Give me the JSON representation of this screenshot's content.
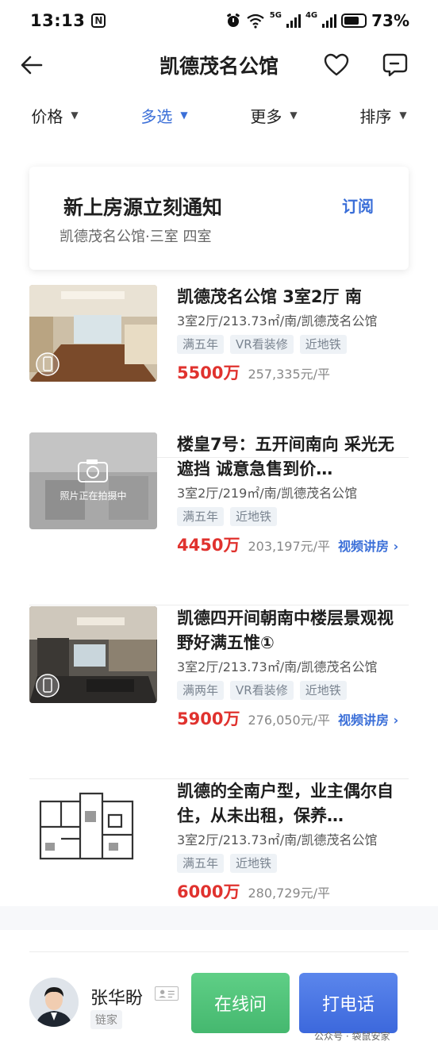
{
  "status_bar": {
    "time": "13:13",
    "nfc_icon": "N",
    "network_5g": "5G",
    "network_4g": "4G",
    "battery_percent": "73%",
    "battery_level": 0.73
  },
  "header": {
    "title": "凯德茂名公馆",
    "back_icon": "arrow-left-icon",
    "favorite_icon": "heart-icon",
    "chat_icon": "chat-icon"
  },
  "filters": [
    {
      "label": "价格",
      "active": false
    },
    {
      "label": "多选",
      "active": true
    },
    {
      "label": "更多",
      "active": false
    },
    {
      "label": "排序",
      "active": false
    }
  ],
  "subscribe_card": {
    "title": "新上房源立刻通知",
    "subtitle": "凯德茂名公馆·三室 四室",
    "button": "订阅"
  },
  "listings": [
    {
      "title": "凯德茂名公馆 3室2厅 南",
      "meta": "3室2厅/213.73㎡/南/凯德茂名公馆",
      "tags": [
        "满五年",
        "VR看装修",
        "近地铁"
      ],
      "price": "5500万",
      "unit_price": "257,335元/平",
      "video_link": ""
    },
    {
      "title": "楼皇7号：五开间南向 采光无遮挡 诚意急售到价…",
      "meta": "3室2厅/219㎡/南/凯德茂名公馆",
      "tags": [
        "满五年",
        "近地铁"
      ],
      "price": "4450万",
      "unit_price": "203,197元/平",
      "video_link": "视频讲房 ›",
      "photo_placeholder": "照片正在拍摄中"
    },
    {
      "title": "凯德四开间朝南中楼层景观视野好满五惟①",
      "meta": "3室2厅/213.73㎡/南/凯德茂名公馆",
      "tags": [
        "满两年",
        "VR看装修",
        "近地铁"
      ],
      "price": "5900万",
      "unit_price": "276,050元/平",
      "video_link": "视频讲房 ›"
    },
    {
      "title": "凯德的全南户型，业主偶尔自住，从未出租，保养…",
      "meta": "3室2厅/213.73㎡/南/凯德茂名公馆",
      "tags": [
        "满五年",
        "近地铁"
      ],
      "price": "6000万",
      "unit_price": "280,729元/平",
      "video_link": ""
    }
  ],
  "agent_bar": {
    "name": "张华盼",
    "brand": "链家",
    "online_button": "在线问",
    "call_button": "打电话",
    "watermark": "公众号 · 袋鼠安家"
  },
  "colors": {
    "accent": "#3b6fd8",
    "price": "#e0322e",
    "online": "#4fc27a",
    "call": "#4a74e0"
  }
}
